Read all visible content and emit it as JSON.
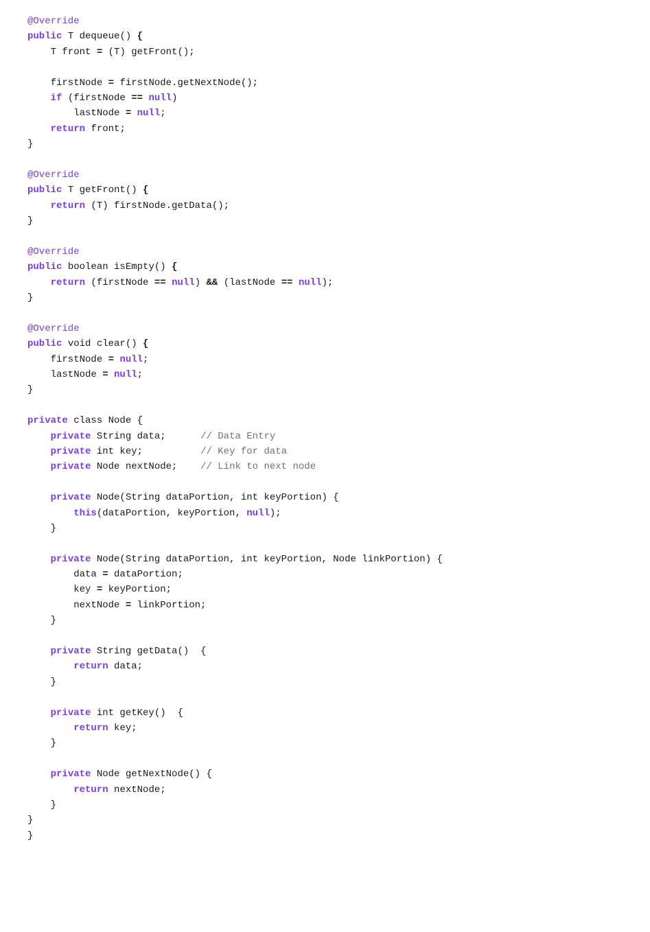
{
  "code": {
    "lines": [
      {
        "tokens": [
          {
            "text": "@Override",
            "cls": "annotation"
          }
        ]
      },
      {
        "tokens": [
          {
            "text": "public",
            "cls": "kw"
          },
          {
            "text": " T dequeue",
            "cls": "plain"
          },
          {
            "text": "()",
            "cls": "plain"
          },
          {
            "text": " {",
            "cls": "bold plain"
          }
        ]
      },
      {
        "tokens": [
          {
            "text": "    T front ",
            "cls": "plain"
          },
          {
            "text": "= ",
            "cls": "bold plain"
          },
          {
            "text": "(T) getFront",
            "cls": "plain"
          },
          {
            "text": "();",
            "cls": "plain"
          }
        ]
      },
      {
        "tokens": []
      },
      {
        "tokens": [
          {
            "text": "    firstNode ",
            "cls": "plain"
          },
          {
            "text": "= ",
            "cls": "bold plain"
          },
          {
            "text": "firstNode.getNextNode",
            "cls": "plain"
          },
          {
            "text": "();",
            "cls": "plain"
          }
        ]
      },
      {
        "tokens": [
          {
            "text": "    ",
            "cls": "plain"
          },
          {
            "text": "if",
            "cls": "kw"
          },
          {
            "text": " (firstNode ",
            "cls": "plain"
          },
          {
            "text": "==",
            "cls": "bold plain"
          },
          {
            "text": " ",
            "cls": "plain"
          },
          {
            "text": "null",
            "cls": "kw"
          },
          {
            "text": ")",
            "cls": "plain"
          }
        ]
      },
      {
        "tokens": [
          {
            "text": "        lastNode ",
            "cls": "plain"
          },
          {
            "text": "= ",
            "cls": "bold plain"
          },
          {
            "text": "null",
            "cls": "kw"
          },
          {
            "text": ";",
            "cls": "plain"
          }
        ]
      },
      {
        "tokens": [
          {
            "text": "    ",
            "cls": "plain"
          },
          {
            "text": "return",
            "cls": "kw"
          },
          {
            "text": " front;",
            "cls": "plain"
          }
        ]
      },
      {
        "tokens": [
          {
            "text": "}",
            "cls": "plain"
          }
        ]
      },
      {
        "tokens": []
      },
      {
        "tokens": [
          {
            "text": "@Override",
            "cls": "annotation"
          }
        ]
      },
      {
        "tokens": [
          {
            "text": "public",
            "cls": "kw"
          },
          {
            "text": " T getFront",
            "cls": "plain"
          },
          {
            "text": "()",
            "cls": "plain"
          },
          {
            "text": " {",
            "cls": "bold plain"
          }
        ]
      },
      {
        "tokens": [
          {
            "text": "    ",
            "cls": "plain"
          },
          {
            "text": "return",
            "cls": "kw"
          },
          {
            "text": " (T) firstNode.getData",
            "cls": "plain"
          },
          {
            "text": "();",
            "cls": "plain"
          }
        ]
      },
      {
        "tokens": [
          {
            "text": "}",
            "cls": "plain"
          }
        ]
      },
      {
        "tokens": []
      },
      {
        "tokens": [
          {
            "text": "@Override",
            "cls": "annotation"
          }
        ]
      },
      {
        "tokens": [
          {
            "text": "public",
            "cls": "kw"
          },
          {
            "text": " boolean isEmpty",
            "cls": "plain"
          },
          {
            "text": "()",
            "cls": "plain"
          },
          {
            "text": " {",
            "cls": "bold plain"
          }
        ]
      },
      {
        "tokens": [
          {
            "text": "    ",
            "cls": "plain"
          },
          {
            "text": "return",
            "cls": "kw"
          },
          {
            "text": " (firstNode ",
            "cls": "plain"
          },
          {
            "text": "==",
            "cls": "bold plain"
          },
          {
            "text": " ",
            "cls": "plain"
          },
          {
            "text": "null",
            "cls": "kw"
          },
          {
            "text": ") ",
            "cls": "plain"
          },
          {
            "text": "&&",
            "cls": "bold plain"
          },
          {
            "text": " (lastNode ",
            "cls": "plain"
          },
          {
            "text": "==",
            "cls": "bold plain"
          },
          {
            "text": " ",
            "cls": "plain"
          },
          {
            "text": "null",
            "cls": "kw"
          },
          {
            "text": ");",
            "cls": "plain"
          }
        ]
      },
      {
        "tokens": [
          {
            "text": "}",
            "cls": "plain"
          }
        ]
      },
      {
        "tokens": []
      },
      {
        "tokens": [
          {
            "text": "@Override",
            "cls": "annotation"
          }
        ]
      },
      {
        "tokens": [
          {
            "text": "public",
            "cls": "kw"
          },
          {
            "text": " void clear",
            "cls": "plain"
          },
          {
            "text": "()",
            "cls": "plain"
          },
          {
            "text": " {",
            "cls": "bold plain"
          }
        ]
      },
      {
        "tokens": [
          {
            "text": "    firstNode ",
            "cls": "plain"
          },
          {
            "text": "= ",
            "cls": "bold plain"
          },
          {
            "text": "null",
            "cls": "kw"
          },
          {
            "text": ";",
            "cls": "plain"
          }
        ]
      },
      {
        "tokens": [
          {
            "text": "    lastNode ",
            "cls": "plain"
          },
          {
            "text": "= ",
            "cls": "bold plain"
          },
          {
            "text": "null",
            "cls": "kw"
          },
          {
            "text": ";",
            "cls": "plain"
          }
        ]
      },
      {
        "tokens": [
          {
            "text": "}",
            "cls": "plain"
          }
        ]
      },
      {
        "tokens": []
      },
      {
        "tokens": [
          {
            "text": "private",
            "cls": "kw"
          },
          {
            "text": " class Node {",
            "cls": "plain"
          }
        ]
      },
      {
        "tokens": [
          {
            "text": "    ",
            "cls": "plain"
          },
          {
            "text": "private",
            "cls": "kw"
          },
          {
            "text": " String data;      ",
            "cls": "plain"
          },
          {
            "text": "// Data Entry",
            "cls": "comment"
          }
        ]
      },
      {
        "tokens": [
          {
            "text": "    ",
            "cls": "plain"
          },
          {
            "text": "private",
            "cls": "kw"
          },
          {
            "text": " int key;          ",
            "cls": "plain"
          },
          {
            "text": "// Key for data",
            "cls": "comment"
          }
        ]
      },
      {
        "tokens": [
          {
            "text": "    ",
            "cls": "plain"
          },
          {
            "text": "private",
            "cls": "kw"
          },
          {
            "text": " Node nextNode;    ",
            "cls": "plain"
          },
          {
            "text": "// Link to next node",
            "cls": "comment"
          }
        ]
      },
      {
        "tokens": []
      },
      {
        "tokens": [
          {
            "text": "    ",
            "cls": "plain"
          },
          {
            "text": "private",
            "cls": "kw"
          },
          {
            "text": " Node(String dataPortion, int keyPortion) {",
            "cls": "plain"
          }
        ]
      },
      {
        "tokens": [
          {
            "text": "        ",
            "cls": "plain"
          },
          {
            "text": "this",
            "cls": "kw"
          },
          {
            "text": "(dataPortion, keyPortion, ",
            "cls": "plain"
          },
          {
            "text": "null",
            "cls": "kw"
          },
          {
            "text": ");",
            "cls": "plain"
          }
        ]
      },
      {
        "tokens": [
          {
            "text": "    }",
            "cls": "plain"
          }
        ]
      },
      {
        "tokens": []
      },
      {
        "tokens": [
          {
            "text": "    ",
            "cls": "plain"
          },
          {
            "text": "private",
            "cls": "kw"
          },
          {
            "text": " Node(String dataPortion, int keyPortion, Node linkPortion) {",
            "cls": "plain"
          }
        ]
      },
      {
        "tokens": [
          {
            "text": "        data ",
            "cls": "plain"
          },
          {
            "text": "= ",
            "cls": "bold plain"
          },
          {
            "text": "dataPortion;",
            "cls": "plain"
          }
        ]
      },
      {
        "tokens": [
          {
            "text": "        key ",
            "cls": "plain"
          },
          {
            "text": "= ",
            "cls": "bold plain"
          },
          {
            "text": "keyPortion;",
            "cls": "plain"
          }
        ]
      },
      {
        "tokens": [
          {
            "text": "        nextNode ",
            "cls": "plain"
          },
          {
            "text": "= ",
            "cls": "bold plain"
          },
          {
            "text": "linkPortion;",
            "cls": "plain"
          }
        ]
      },
      {
        "tokens": [
          {
            "text": "    }",
            "cls": "plain"
          }
        ]
      },
      {
        "tokens": []
      },
      {
        "tokens": [
          {
            "text": "    ",
            "cls": "plain"
          },
          {
            "text": "private",
            "cls": "kw"
          },
          {
            "text": " String getData",
            "cls": "plain"
          },
          {
            "text": "()",
            "cls": "plain"
          },
          {
            "text": "  {",
            "cls": "plain"
          }
        ]
      },
      {
        "tokens": [
          {
            "text": "        ",
            "cls": "plain"
          },
          {
            "text": "return",
            "cls": "kw"
          },
          {
            "text": " data;",
            "cls": "plain"
          }
        ]
      },
      {
        "tokens": [
          {
            "text": "    }",
            "cls": "plain"
          }
        ]
      },
      {
        "tokens": []
      },
      {
        "tokens": [
          {
            "text": "    ",
            "cls": "plain"
          },
          {
            "text": "private",
            "cls": "kw"
          },
          {
            "text": " int getKey",
            "cls": "plain"
          },
          {
            "text": "()",
            "cls": "plain"
          },
          {
            "text": "  {",
            "cls": "plain"
          }
        ]
      },
      {
        "tokens": [
          {
            "text": "        ",
            "cls": "plain"
          },
          {
            "text": "return",
            "cls": "kw"
          },
          {
            "text": " key;",
            "cls": "plain"
          }
        ]
      },
      {
        "tokens": [
          {
            "text": "    }",
            "cls": "plain"
          }
        ]
      },
      {
        "tokens": []
      },
      {
        "tokens": [
          {
            "text": "    ",
            "cls": "plain"
          },
          {
            "text": "private",
            "cls": "kw"
          },
          {
            "text": " Node getNextNode",
            "cls": "plain"
          },
          {
            "text": "() {",
            "cls": "plain"
          }
        ]
      },
      {
        "tokens": [
          {
            "text": "        ",
            "cls": "plain"
          },
          {
            "text": "return",
            "cls": "kw"
          },
          {
            "text": " nextNode;",
            "cls": "plain"
          }
        ]
      },
      {
        "tokens": [
          {
            "text": "    }",
            "cls": "plain"
          }
        ]
      },
      {
        "tokens": [
          {
            "text": "}",
            "cls": "plain"
          }
        ]
      },
      {
        "tokens": [
          {
            "text": "}",
            "cls": "plain"
          }
        ]
      }
    ]
  }
}
